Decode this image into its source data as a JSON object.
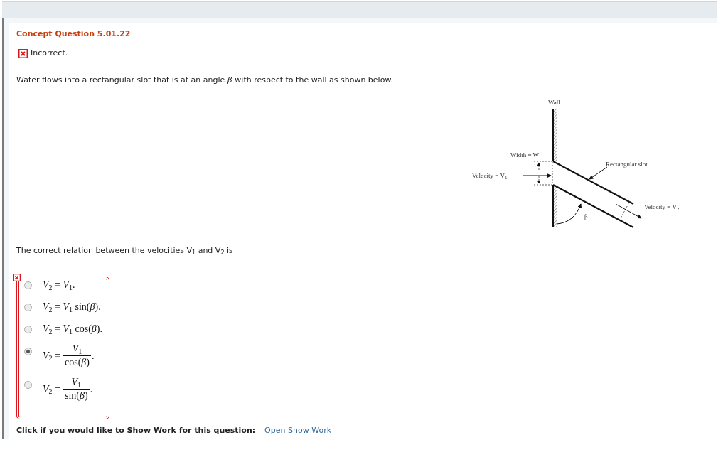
{
  "header": {
    "title": "Concept Question 5.01.22"
  },
  "feedback": {
    "text": "Incorrect.",
    "correct": false
  },
  "prompt": "Water flows into a rectangular slot that is at an angle *β* with respect to the wall as shown below.",
  "figure": {
    "labels": [
      {
        "kind": "wall",
        "text": "Wall"
      },
      {
        "kind": "width",
        "text": "Width = W"
      },
      {
        "kind": "slot",
        "text": "Rectangular slot"
      },
      {
        "kind": "inlet",
        "text": "Velocity = V$_{1}$"
      },
      {
        "kind": "outlet",
        "text": "Velocity = V$_{2}$"
      },
      {
        "kind": "angle",
        "text": "β"
      }
    ]
  },
  "question": "The correct relation between the velocities V$_{1}$ and V$_{2}$ is",
  "answers": {
    "correct": false,
    "options": [
      {
        "kind": "inline",
        "text": "*V*$_{2}$ = *V*$_{1}$.",
        "selected": false
      },
      {
        "kind": "inline",
        "text": "*V*$_{2}$ = *V*$_{1}$ sin(*β*).",
        "selected": false
      },
      {
        "kind": "inline",
        "text": "*V*$_{2}$ = *V*$_{1}$ cos(*β*).",
        "selected": false
      },
      {
        "kind": "fraction",
        "lhs": "*V*$_{2}$ =",
        "numerator": "*V*$_{1}$",
        "denominator": "cos(*β*)",
        "suffix": ".",
        "selected": true
      },
      {
        "kind": "fraction",
        "lhs": "*V*$_{2}$ =",
        "numerator": "*V*$_{1}$",
        "denominator": "sin(*β*)",
        "suffix": ".",
        "selected": false
      }
    ]
  },
  "show_work": {
    "label": "Click if you would like to Show Work for this question:",
    "link": "Open Show Work"
  }
}
